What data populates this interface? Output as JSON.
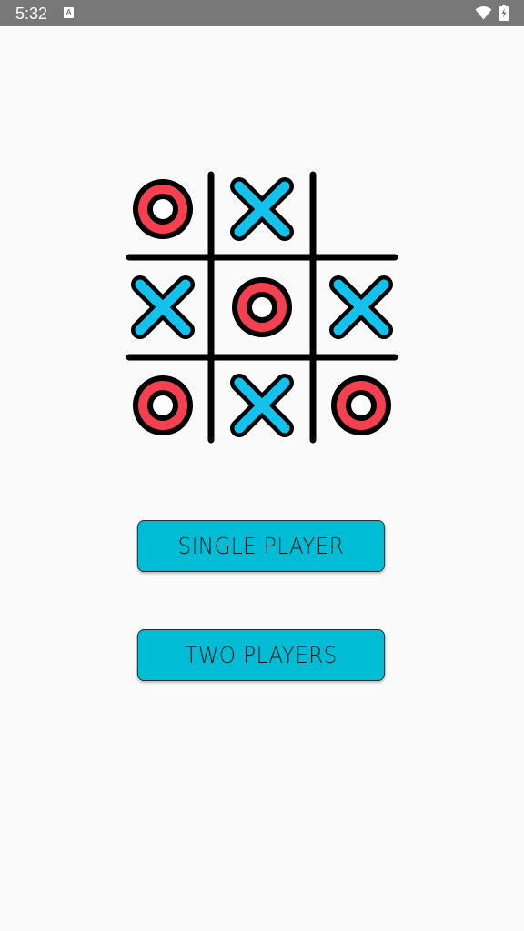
{
  "status_bar": {
    "time": "5:32",
    "notification_icon": "accessibility-a-icon",
    "notification_glyph": "A",
    "wifi_icon": "wifi-icon",
    "battery_icon": "battery-charging-icon"
  },
  "logo": {
    "icon": "tic-tac-toe-board-icon",
    "cells": [
      "O",
      "X",
      "",
      "X",
      "O",
      "X",
      "O",
      "X",
      "O"
    ],
    "colors": {
      "o_fill": "#f5404f",
      "x_fill": "#13c2ec",
      "outline": "#000000"
    }
  },
  "menu": {
    "single_player_label": "SINGLE PLAYER",
    "two_players_label": "TWO PLAYERS",
    "button_color": "#00bcd4"
  }
}
